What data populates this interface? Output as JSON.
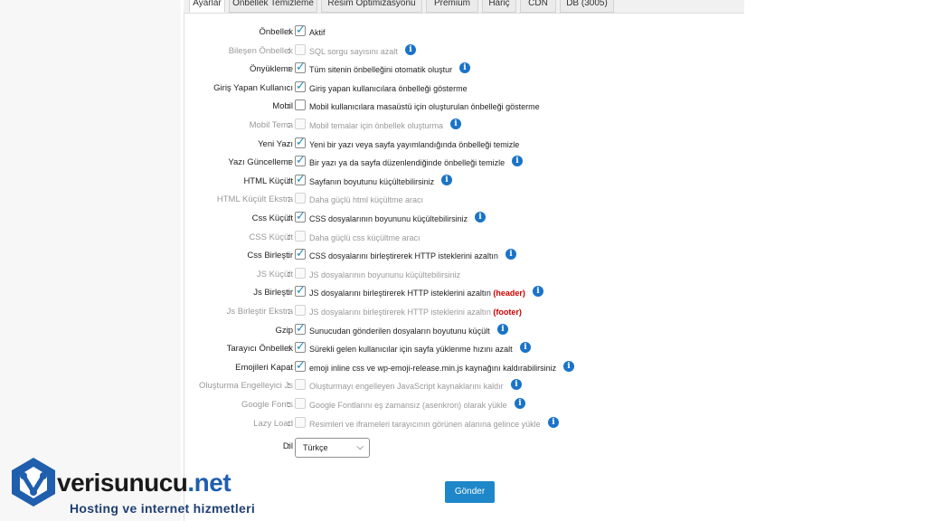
{
  "tabs": [
    {
      "label": "Ayarlar"
    },
    {
      "label": "Önbellek Temizleme"
    },
    {
      "label": "Resim Optimizasyonu"
    },
    {
      "label": "Premium"
    },
    {
      "label": "Hariç"
    },
    {
      "label": "CDN"
    },
    {
      "label": "DB (3005)"
    }
  ],
  "settings": [
    {
      "label": "Önbellek",
      "desc": "Aktif",
      "checked": true,
      "enabled": true,
      "info": false
    },
    {
      "label": "Bileşen Önbellek",
      "desc": "SQL sorgu sayısını azalt",
      "checked": false,
      "enabled": false,
      "info": true
    },
    {
      "label": "Önyükleme",
      "desc": "Tüm sitenin önbelleğini otomatik oluştur",
      "checked": true,
      "enabled": true,
      "info": true
    },
    {
      "label": "Giriş Yapan Kullanıcı",
      "desc": "Giriş yapan kullanıcılara önbelleği gösterme",
      "checked": true,
      "enabled": true,
      "info": false
    },
    {
      "label": "Mobil",
      "desc": "Mobil kullanıcılara masaüstü için oluşturulan önbelleği gösterme",
      "checked": false,
      "enabled": true,
      "info": false
    },
    {
      "label": "Mobil Tema",
      "desc": "Mobil temalar için önbellek oluşturma",
      "checked": false,
      "enabled": false,
      "info": true
    },
    {
      "label": "Yeni Yazı",
      "desc": "Yeni bir yazı veya sayfa yayımlandığında önbelleği temizle",
      "checked": true,
      "enabled": true,
      "info": false
    },
    {
      "label": "Yazı Güncelleme",
      "desc": "Bir yazı ya da sayfa düzenlendiğinde önbelleği temizle",
      "checked": true,
      "enabled": true,
      "info": true
    },
    {
      "label": "HTML Küçült",
      "desc": "Sayfanın boyutunu küçültebilirsiniz",
      "checked": true,
      "enabled": true,
      "info": true
    },
    {
      "label": "HTML Küçült Ekstra",
      "desc": "Daha güçlü html küçültme aracı",
      "checked": false,
      "enabled": false,
      "info": false
    },
    {
      "label": "Css Küçült",
      "desc": "CSS dosyalarının boyununu küçültebilirsiniz",
      "checked": true,
      "enabled": true,
      "info": true
    },
    {
      "label": "CSS Küçült",
      "desc": "Daha güçlü css küçültme aracı",
      "checked": false,
      "enabled": false,
      "info": false
    },
    {
      "label": "Css Birleştir",
      "desc": "CSS dosyalarını birleştirerek HTTP isteklerini azaltın",
      "checked": true,
      "enabled": true,
      "info": true
    },
    {
      "label": "JS Küçült",
      "desc": "JS dosyalarının boyununu küçültebilirsiniz",
      "checked": false,
      "enabled": false,
      "info": false
    },
    {
      "label": "Js Birleştir",
      "desc": "JS dosyalarını birleştirerek HTTP isteklerini azaltın",
      "suffix": "(header)",
      "checked": true,
      "enabled": true,
      "info": true
    },
    {
      "label": "Js Birleştir Ekstra",
      "desc": "JS dosyalarını birleştirerek HTTP isteklerini azaltın",
      "suffix": "(footer)",
      "checked": false,
      "enabled": false,
      "info": false
    },
    {
      "label": "Gzip",
      "desc": "Sunucudan gönderilen dosyaların boyutunu küçült",
      "checked": true,
      "enabled": true,
      "info": true
    },
    {
      "label": "Tarayıcı Önbellek",
      "desc": "Sürekli gelen kullanıcılar için sayfa yüklenme hızını azalt",
      "checked": true,
      "enabled": true,
      "info": true
    },
    {
      "label": "Emojileri Kapat",
      "desc": "emoji inline css ve wp-emoji-release.min.js kaynağını kaldırabilirsiniz",
      "checked": true,
      "enabled": true,
      "info": true
    },
    {
      "label": "Oluşturma Engelleyici Js",
      "desc": "Oluşturmayı engelleyen JavaScript kaynaklarını kaldır",
      "checked": false,
      "enabled": false,
      "info": true
    },
    {
      "label": "Google Fonts",
      "desc": "Google Fontlarını eş zamansız (asenkron) olarak yükle",
      "checked": false,
      "enabled": false,
      "info": true
    },
    {
      "label": "Lazy Load",
      "desc": "Resimleri ve iframeleri tarayıcının görünen alanına gelince yükle",
      "checked": false,
      "enabled": false,
      "info": true
    }
  ],
  "language": {
    "label": "Dil",
    "selected": "Türkçe"
  },
  "submit_label": "Gönder",
  "logo": {
    "name_a": "verisunucu",
    "name_b": ".net",
    "tagline": "Hosting ve internet hizmetleri"
  },
  "colors": {
    "accent": "#1e87c9",
    "checkbox_tick": "#1e8cbe",
    "info_icon": "#1a73c8",
    "logo_blue": "#1f5fae"
  }
}
